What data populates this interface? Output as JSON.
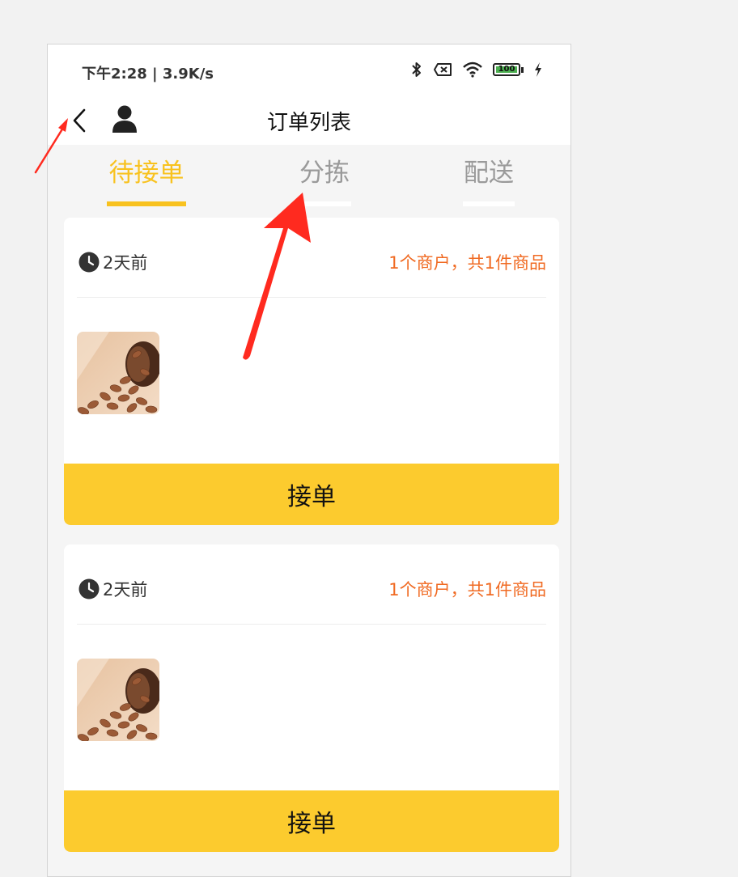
{
  "status_bar": {
    "time_speed": "下午2:28 | 3.9K/s",
    "battery_level": "100",
    "icons": [
      "bluetooth-icon",
      "sim-off-icon",
      "wifi-icon",
      "battery-icon",
      "charging-icon"
    ]
  },
  "nav": {
    "title": "订单列表",
    "back_icon": "chevron-left-icon",
    "user_icon": "user-icon"
  },
  "tabs": [
    {
      "label": "待接单",
      "active": true
    },
    {
      "label": "分拣",
      "active": false
    },
    {
      "label": "配送",
      "active": false
    }
  ],
  "orders": [
    {
      "time": "2天前",
      "summary": "1个商户，共1件商品",
      "thumbnail": "almonds-product-image",
      "action_label": "接单"
    },
    {
      "time": "2天前",
      "summary": "1个商户，共1件商品",
      "thumbnail": "almonds-product-image",
      "action_label": "接单"
    }
  ],
  "colors": {
    "accent": "#f8c21f",
    "button": "#fccb2e",
    "summary_text": "#f06a22",
    "annotation_arrow": "#ff2a1f"
  }
}
